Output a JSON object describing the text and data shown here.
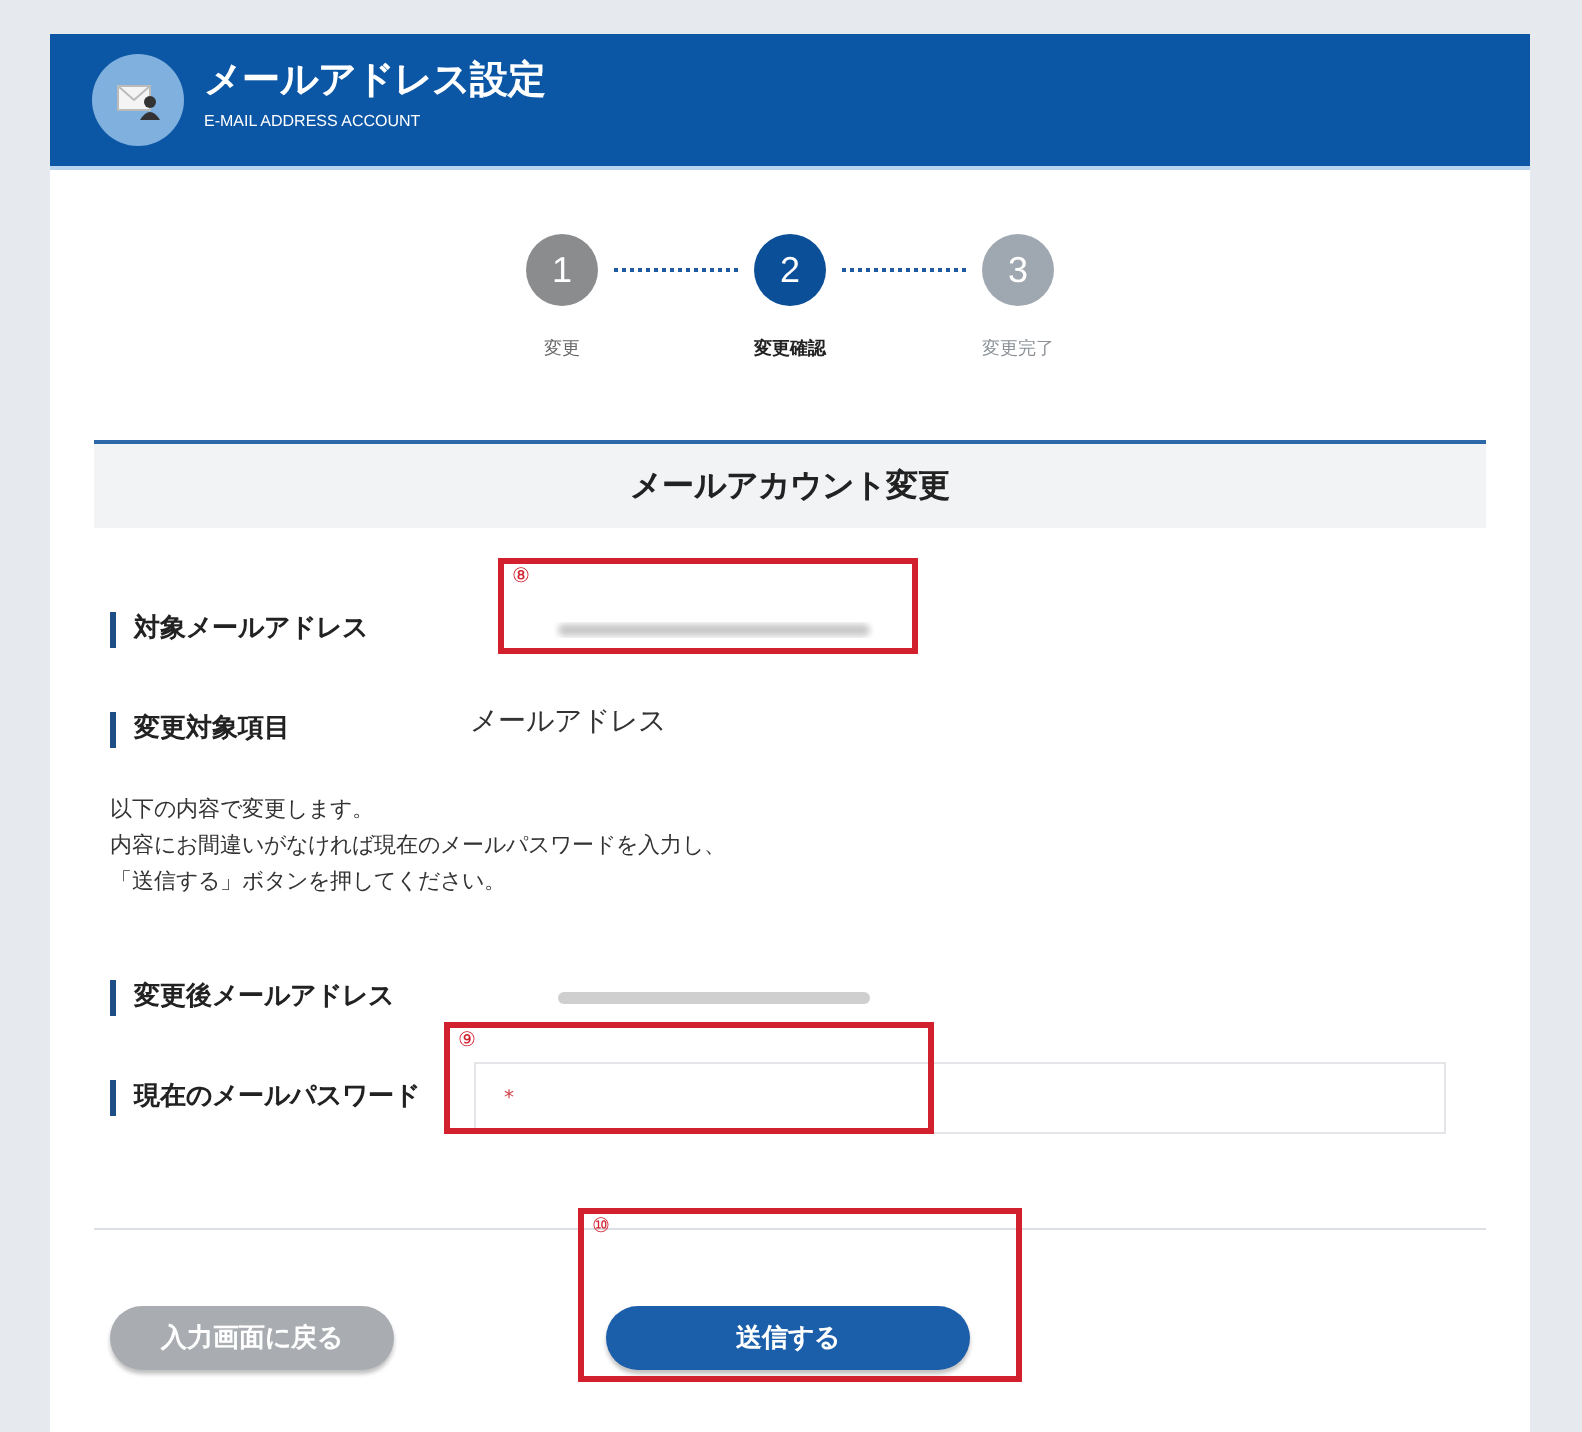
{
  "header": {
    "title": "メールアドレス設定",
    "subtitle": "E-MAIL ADDRESS ACCOUNT"
  },
  "steps": [
    {
      "number": "1",
      "label": "変更",
      "selected": false,
      "completed": true
    },
    {
      "number": "2",
      "label": "変更確認",
      "selected": true,
      "completed": false
    },
    {
      "number": "3",
      "label": "変更完了",
      "selected": false,
      "completed": false
    }
  ],
  "section": {
    "title": "メールアカウント変更"
  },
  "rows": [
    {
      "kind": "redacted",
      "label": "対象メールアドレス"
    },
    {
      "kind": "text",
      "label": "変更対象項目",
      "value": "メールアドレス"
    }
  ],
  "instructions": [
    "以下の内容で変更します。",
    "内容にお間違いがなければ現在のメールパスワードを入力し、",
    "「送信する」ボタンを押してください。"
  ],
  "rows2": [
    {
      "kind": "redacted",
      "label": "変更後メールアドレス"
    },
    {
      "kind": "input",
      "label": "現在のメールパスワード",
      "required_mark": "*"
    }
  ],
  "buttons": [
    {
      "kind": "secondary",
      "label": "入力画面に戻る"
    },
    {
      "kind": "primary",
      "label": "送信する"
    }
  ],
  "annotations": [
    {
      "mark": "⑧"
    },
    {
      "mark": "⑨"
    },
    {
      "mark": "⑩"
    }
  ]
}
